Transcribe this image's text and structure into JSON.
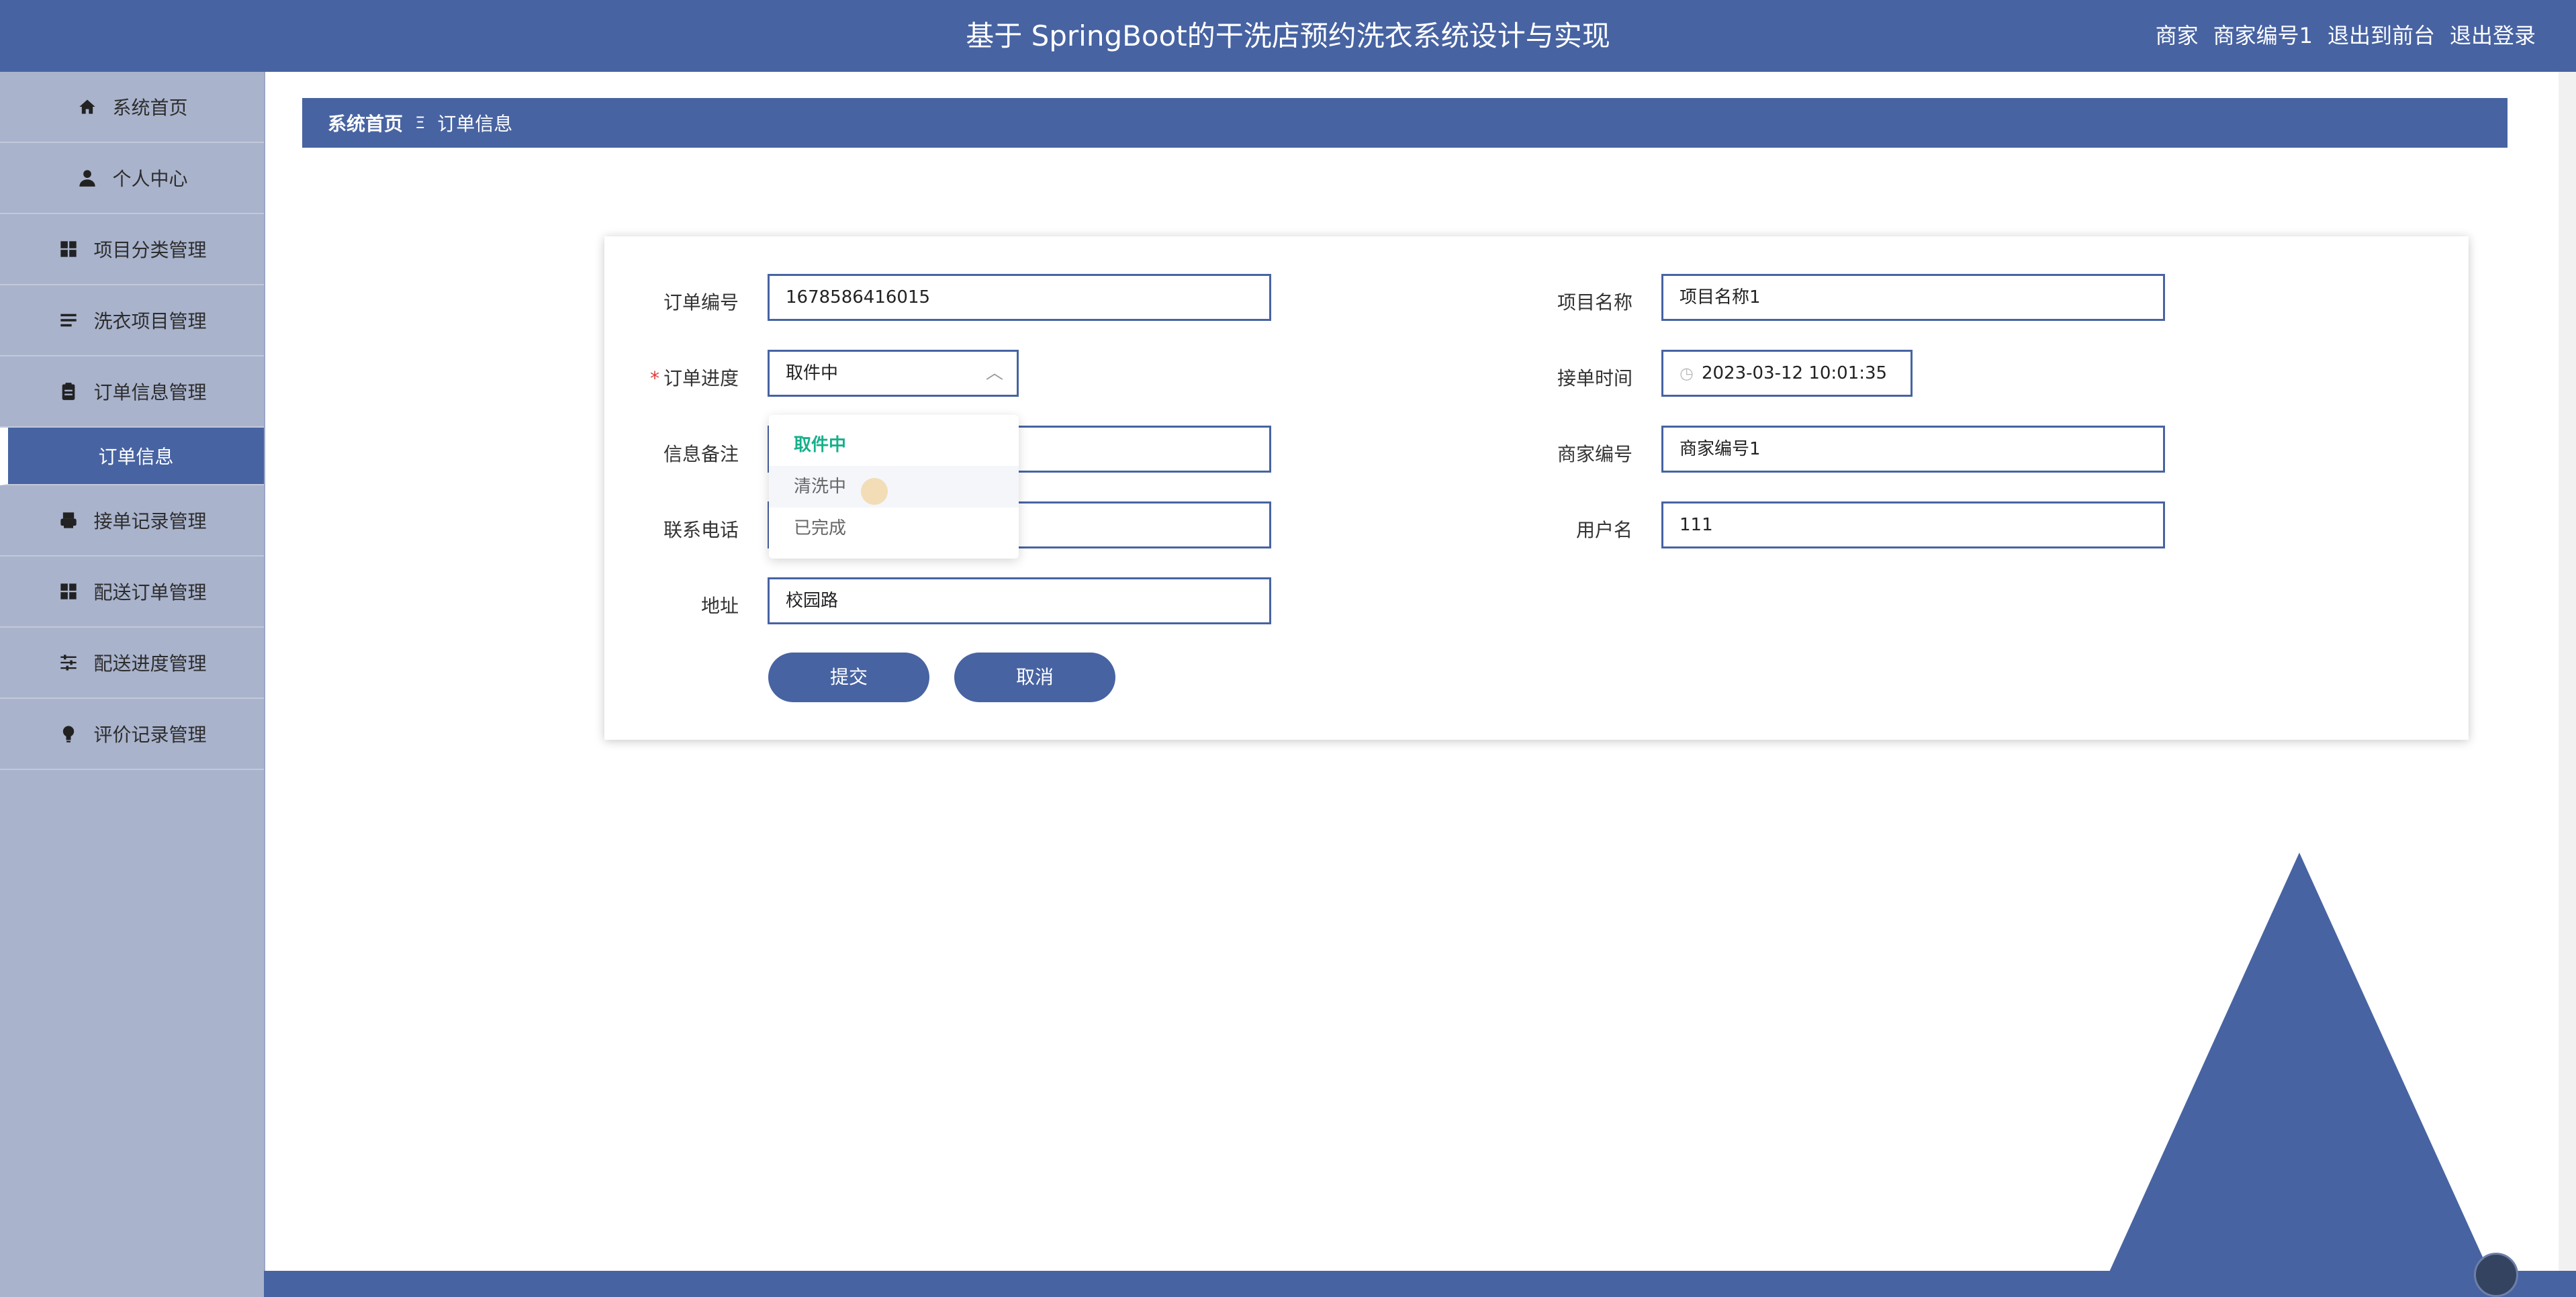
{
  "header": {
    "title": "基于 SpringBoot的干洗店预约洗衣系统设计与实现",
    "user_role": "商家",
    "user_name": "商家编号1",
    "front_link": "退出到前台",
    "logout_link": "退出登录"
  },
  "sidebar": {
    "items": [
      {
        "label": "系统首页",
        "icon": "home-icon"
      },
      {
        "label": "个人中心",
        "icon": "user-icon"
      },
      {
        "label": "项目分类管理",
        "icon": "grid-icon"
      },
      {
        "label": "洗衣项目管理",
        "icon": "list-icon"
      },
      {
        "label": "订单信息管理",
        "icon": "clipboard-icon"
      },
      {
        "label": "订单信息",
        "icon": ""
      },
      {
        "label": "接单记录管理",
        "icon": "printer-icon"
      },
      {
        "label": "配送订单管理",
        "icon": "grid-icon"
      },
      {
        "label": "配送进度管理",
        "icon": "sliders-icon"
      },
      {
        "label": "评价记录管理",
        "icon": "bulb-icon"
      }
    ]
  },
  "breadcrumb": {
    "home": "系统首页",
    "separator": "Ξ",
    "current": "订单信息"
  },
  "form": {
    "order_no_label": "订单编号",
    "order_no_value": "1678586416015",
    "progress_label": "订单进度",
    "progress_value": "取件中",
    "note_label": "信息备注",
    "note_value": "",
    "phone_label": "联系电话",
    "phone_value": "",
    "address_label": "地址",
    "address_value": "校园路",
    "project_label": "项目名称",
    "project_value": "项目名称1",
    "accept_time_label": "接单时间",
    "accept_time_value": "2023-03-12 10:01:35",
    "merchant_label": "商家编号",
    "merchant_value": "商家编号1",
    "username_label": "用户名",
    "username_value": "111",
    "submit_label": "提交",
    "cancel_label": "取消"
  },
  "dropdown": {
    "options": [
      "取件中",
      "清洗中",
      "已完成"
    ],
    "selected": "取件中",
    "hovered": "清洗中"
  },
  "colors": {
    "primary": "#4763a2",
    "sidebar": "#a9b3cc",
    "selected_option": "#16b08b"
  }
}
